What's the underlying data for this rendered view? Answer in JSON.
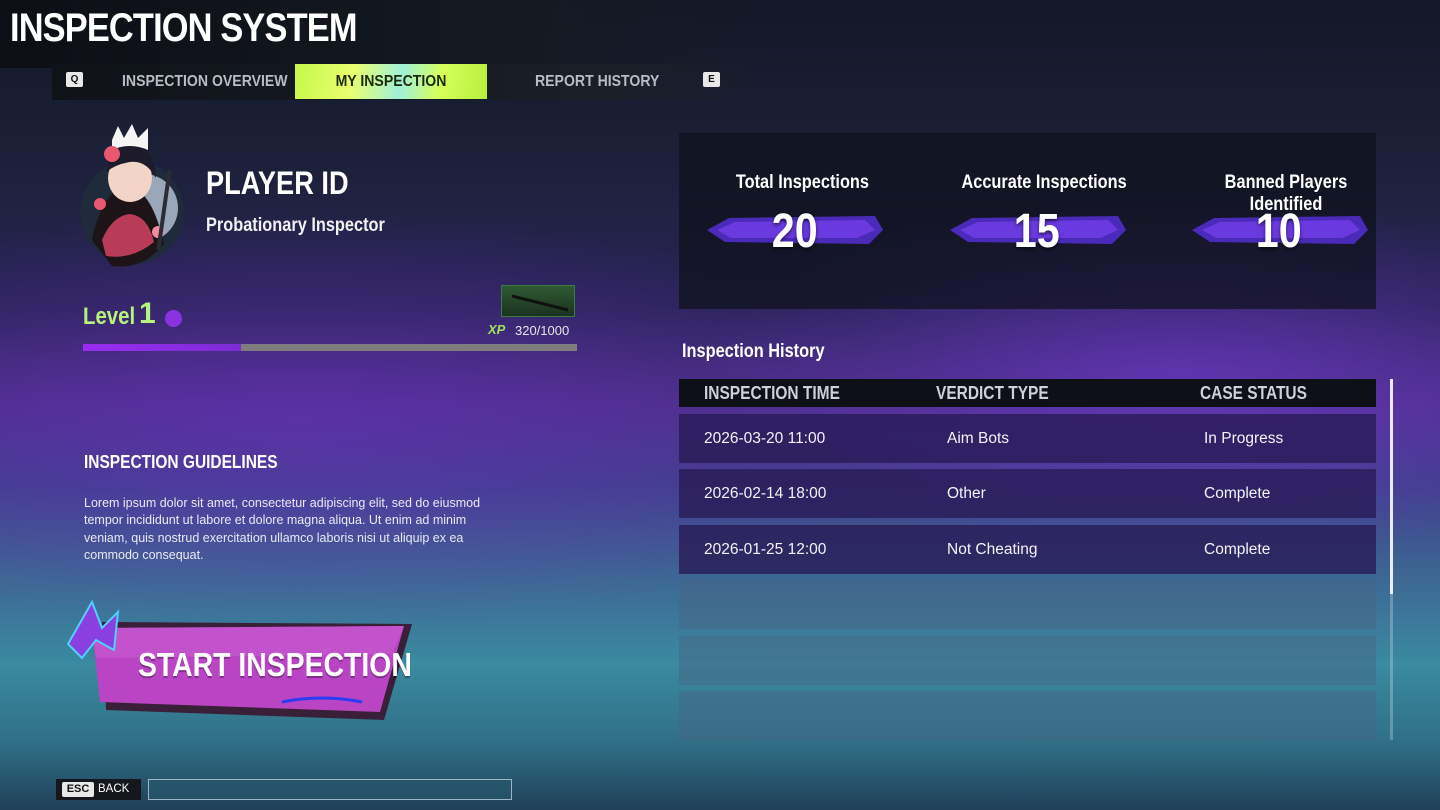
{
  "app": {
    "title": "INSPECTION SYSTEM"
  },
  "nav": {
    "prev_key": "Q",
    "next_key": "E",
    "tabs": [
      {
        "label": "INSPECTION OVERVIEW",
        "active": false
      },
      {
        "label": "MY INSPECTION",
        "active": true
      },
      {
        "label": "REPORT HISTORY",
        "active": false
      }
    ]
  },
  "profile": {
    "player_id": "PLAYER ID",
    "rank": "Probationary Inspector",
    "level_label": "Level",
    "level": "1",
    "xp_icon": "XP",
    "xp_text": "320/1000",
    "xp_progress": 0.32
  },
  "guidelines": {
    "title": "INSPECTION GUIDELINES",
    "body": "Lorem ipsum dolor sit amet, consectetur adipiscing elit, sed do eiusmod tempor incididunt ut labore et dolore magna aliqua. Ut enim ad minim veniam, quis nostrud exercitation ullamco laboris nisi ut aliquip ex ea commodo consequat."
  },
  "start_button": {
    "label": "START INSPECTION"
  },
  "stats": [
    {
      "label": "Total Inspections",
      "value": "20"
    },
    {
      "label": "Accurate Inspections",
      "value": "15"
    },
    {
      "label": "Banned Players Identified",
      "value": "10"
    }
  ],
  "history": {
    "title": "Inspection History",
    "columns": [
      "INSPECTION TIME",
      "VERDICT TYPE",
      "CASE STATUS"
    ],
    "rows": [
      {
        "time": "2026-03-20 11:00",
        "verdict": "Aim Bots",
        "status": "In Progress"
      },
      {
        "time": "2026-02-14 18:00",
        "verdict": "Other",
        "status": "Complete"
      },
      {
        "time": "2026-01-25 12:00",
        "verdict": "Not Cheating",
        "status": "Complete"
      }
    ]
  },
  "footer": {
    "esc_key": "ESC",
    "back_label": "BACK"
  },
  "colors": {
    "accent_lime": "#c6f74a",
    "accent_purple": "#9b2cf0",
    "level_green": "#b7f27a"
  }
}
